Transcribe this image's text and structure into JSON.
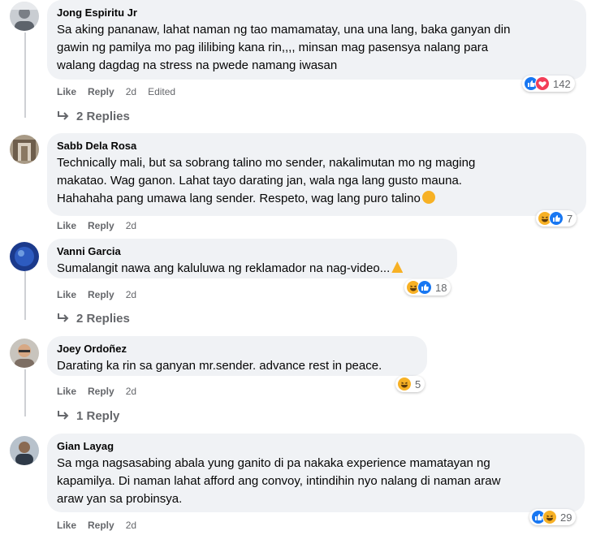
{
  "comments": [
    {
      "author": "Jong Espiritu Jr",
      "text": "Sa aking pananaw, lahat naman ng tao mamamatay, una una lang, baka ganyan din\ngawin ng pamilya mo pag ililibing kana rin,,,, minsan mag pasensya nalang para\nwalang dagdag na stress na pwede namang iwasan",
      "like_label": "Like",
      "reply_label": "Reply",
      "time": "2d",
      "edited": "Edited",
      "reaction_count": "142",
      "replies_label": "2 Replies"
    },
    {
      "author": "Sabb Dela Rosa",
      "text": "Technically mali, but sa sobrang talino mo sender, nakalimutan mo ng maging\nmakatao. Wag ganon. Lahat tayo darating jan, wala nga lang gusto mauna.\nHahahaha pang umawa lang sender. Respeto, wag lang puro talino",
      "like_label": "Like",
      "reply_label": "Reply",
      "time": "2d",
      "reaction_count": "7"
    },
    {
      "author": "Vanni Garcia",
      "text": "Sumalangit nawa ang kaluluwa ng reklamador na nag-video...",
      "like_label": "Like",
      "reply_label": "Reply",
      "time": "2d",
      "reaction_count": "18",
      "replies_label": "2 Replies"
    },
    {
      "author": "Joey Ordoñez",
      "text": "Darating ka rin sa ganyan mr.sender. advance rest in peace.",
      "like_label": "Like",
      "reply_label": "Reply",
      "time": "2d",
      "reaction_count": "5",
      "replies_label": "1 Reply"
    },
    {
      "author": "Gian Layag",
      "text": "Sa mga nagsasabing abala yung ganito di pa nakaka experience mamatayan ng\nkapamilya. Di naman lahat afford ang convoy, intindihin nyo nalang di naman araw\naraw yan sa probinsya.",
      "like_label": "Like",
      "reply_label": "Reply",
      "time": "2d",
      "reaction_count": "29"
    }
  ],
  "colors": {
    "bubble": "#f0f2f5",
    "meta": "#65676b",
    "like": "#1877f2",
    "love": "#f33e58",
    "haha": "#f7b125"
  }
}
